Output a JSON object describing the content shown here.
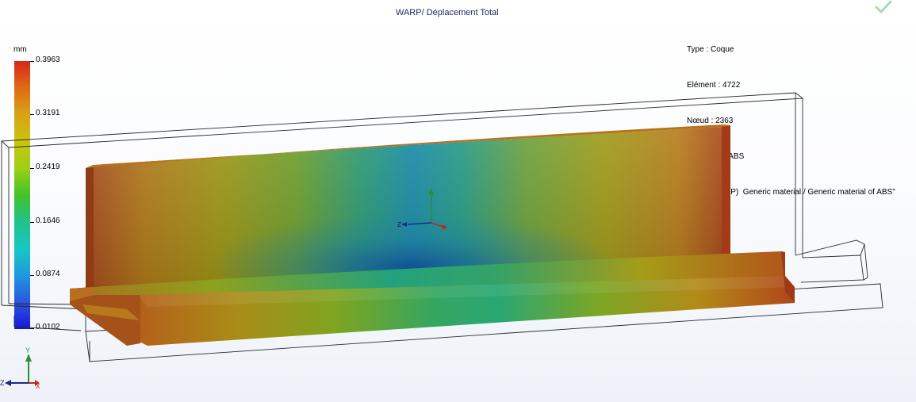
{
  "plot": {
    "title": "WARP/ Déplacement Total"
  },
  "info": {
    "type_line": "Type : Coque",
    "element_line": "Elément : 4722",
    "node_line": "Nœud : 2363",
    "material_line": "Matériau : : ABS",
    "product_line": "Produit :    \"(P)  Generic material / Generic material of ABS\""
  },
  "legend": {
    "unit": "mm",
    "ticks": [
      "0.3963",
      "0.3191",
      "0.2419",
      "0.1646",
      "0.0874",
      "0.0102"
    ]
  },
  "triad_center": {
    "labels": [
      "Y",
      "Z"
    ]
  },
  "triad_corner": {
    "labels": [
      "Y",
      "Z",
      "X"
    ]
  },
  "icons": {
    "check": "checkmark-icon"
  }
}
